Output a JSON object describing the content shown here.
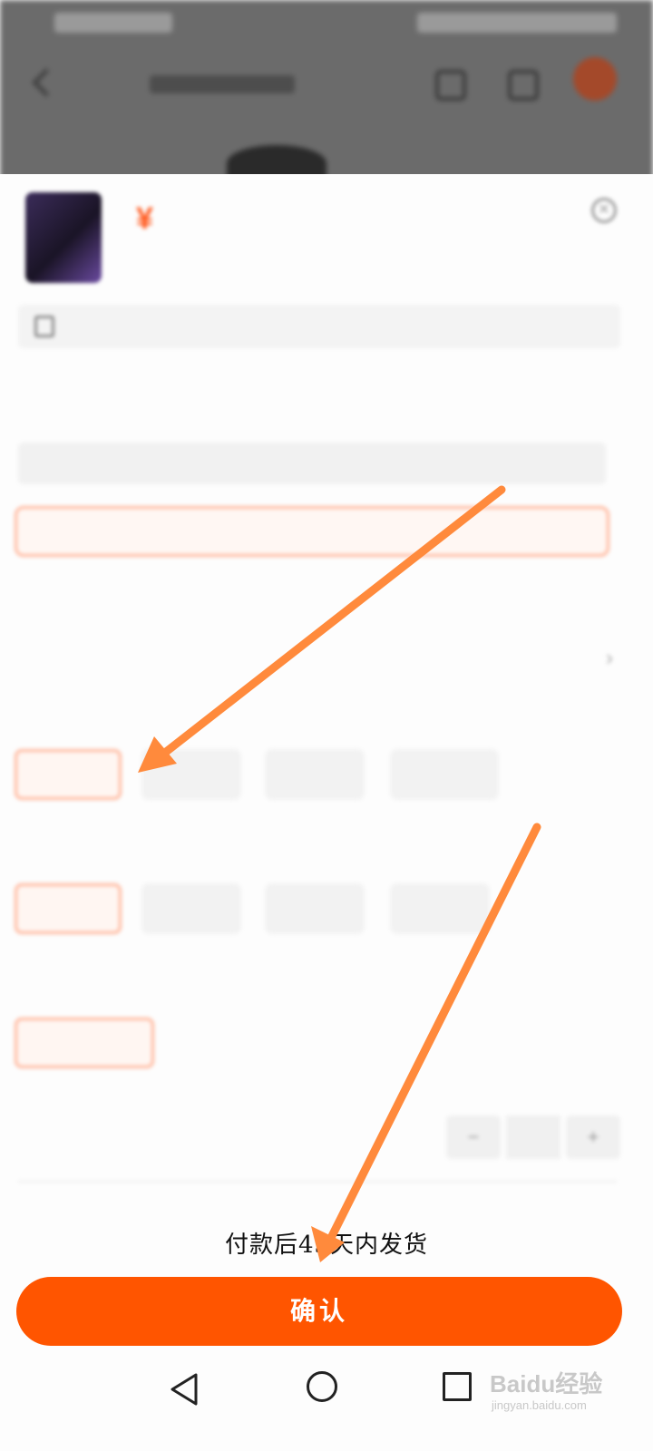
{
  "sheet": {
    "price": "¥      ",
    "info": {
      "label": "",
      "value": ""
    },
    "model": {
      "title": "",
      "current": "",
      "selected": ""
    },
    "hint": {
      "title": "",
      "sub": "",
      "value": ""
    },
    "option_groups": [
      {
        "title": "",
        "options": [
          "",
          "",
          "",
          ""
        ]
      },
      {
        "title": "",
        "options": [
          "",
          "",
          "",
          ""
        ]
      },
      {
        "title": "",
        "options": [
          ""
        ]
      }
    ],
    "quantity": {
      "title": "",
      "note": "",
      "value": ""
    },
    "note_title": ""
  },
  "footer": {
    "delivery_text": "付款后43天内发货",
    "confirm_label": "确认"
  },
  "watermark": {
    "brand": "Baidu经验",
    "url": "jingyan.baidu.com"
  },
  "colors": {
    "accent": "#ff5500",
    "arrow": "#ff8a3c"
  }
}
